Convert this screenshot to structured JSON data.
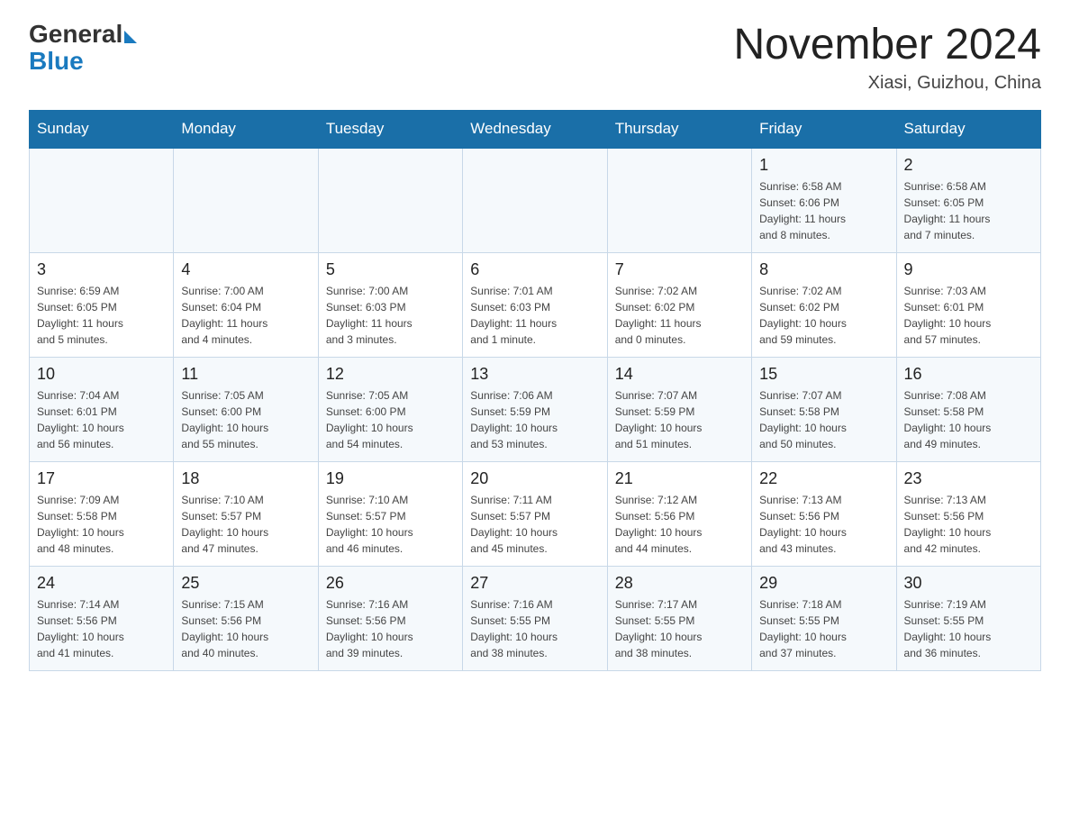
{
  "header": {
    "logo_general": "General",
    "logo_blue": "Blue",
    "title": "November 2024",
    "subtitle": "Xiasi, Guizhou, China"
  },
  "weekdays": [
    "Sunday",
    "Monday",
    "Tuesday",
    "Wednesday",
    "Thursday",
    "Friday",
    "Saturday"
  ],
  "weeks": [
    [
      {
        "day": "",
        "info": ""
      },
      {
        "day": "",
        "info": ""
      },
      {
        "day": "",
        "info": ""
      },
      {
        "day": "",
        "info": ""
      },
      {
        "day": "",
        "info": ""
      },
      {
        "day": "1",
        "info": "Sunrise: 6:58 AM\nSunset: 6:06 PM\nDaylight: 11 hours\nand 8 minutes."
      },
      {
        "day": "2",
        "info": "Sunrise: 6:58 AM\nSunset: 6:05 PM\nDaylight: 11 hours\nand 7 minutes."
      }
    ],
    [
      {
        "day": "3",
        "info": "Sunrise: 6:59 AM\nSunset: 6:05 PM\nDaylight: 11 hours\nand 5 minutes."
      },
      {
        "day": "4",
        "info": "Sunrise: 7:00 AM\nSunset: 6:04 PM\nDaylight: 11 hours\nand 4 minutes."
      },
      {
        "day": "5",
        "info": "Sunrise: 7:00 AM\nSunset: 6:03 PM\nDaylight: 11 hours\nand 3 minutes."
      },
      {
        "day": "6",
        "info": "Sunrise: 7:01 AM\nSunset: 6:03 PM\nDaylight: 11 hours\nand 1 minute."
      },
      {
        "day": "7",
        "info": "Sunrise: 7:02 AM\nSunset: 6:02 PM\nDaylight: 11 hours\nand 0 minutes."
      },
      {
        "day": "8",
        "info": "Sunrise: 7:02 AM\nSunset: 6:02 PM\nDaylight: 10 hours\nand 59 minutes."
      },
      {
        "day": "9",
        "info": "Sunrise: 7:03 AM\nSunset: 6:01 PM\nDaylight: 10 hours\nand 57 minutes."
      }
    ],
    [
      {
        "day": "10",
        "info": "Sunrise: 7:04 AM\nSunset: 6:01 PM\nDaylight: 10 hours\nand 56 minutes."
      },
      {
        "day": "11",
        "info": "Sunrise: 7:05 AM\nSunset: 6:00 PM\nDaylight: 10 hours\nand 55 minutes."
      },
      {
        "day": "12",
        "info": "Sunrise: 7:05 AM\nSunset: 6:00 PM\nDaylight: 10 hours\nand 54 minutes."
      },
      {
        "day": "13",
        "info": "Sunrise: 7:06 AM\nSunset: 5:59 PM\nDaylight: 10 hours\nand 53 minutes."
      },
      {
        "day": "14",
        "info": "Sunrise: 7:07 AM\nSunset: 5:59 PM\nDaylight: 10 hours\nand 51 minutes."
      },
      {
        "day": "15",
        "info": "Sunrise: 7:07 AM\nSunset: 5:58 PM\nDaylight: 10 hours\nand 50 minutes."
      },
      {
        "day": "16",
        "info": "Sunrise: 7:08 AM\nSunset: 5:58 PM\nDaylight: 10 hours\nand 49 minutes."
      }
    ],
    [
      {
        "day": "17",
        "info": "Sunrise: 7:09 AM\nSunset: 5:58 PM\nDaylight: 10 hours\nand 48 minutes."
      },
      {
        "day": "18",
        "info": "Sunrise: 7:10 AM\nSunset: 5:57 PM\nDaylight: 10 hours\nand 47 minutes."
      },
      {
        "day": "19",
        "info": "Sunrise: 7:10 AM\nSunset: 5:57 PM\nDaylight: 10 hours\nand 46 minutes."
      },
      {
        "day": "20",
        "info": "Sunrise: 7:11 AM\nSunset: 5:57 PM\nDaylight: 10 hours\nand 45 minutes."
      },
      {
        "day": "21",
        "info": "Sunrise: 7:12 AM\nSunset: 5:56 PM\nDaylight: 10 hours\nand 44 minutes."
      },
      {
        "day": "22",
        "info": "Sunrise: 7:13 AM\nSunset: 5:56 PM\nDaylight: 10 hours\nand 43 minutes."
      },
      {
        "day": "23",
        "info": "Sunrise: 7:13 AM\nSunset: 5:56 PM\nDaylight: 10 hours\nand 42 minutes."
      }
    ],
    [
      {
        "day": "24",
        "info": "Sunrise: 7:14 AM\nSunset: 5:56 PM\nDaylight: 10 hours\nand 41 minutes."
      },
      {
        "day": "25",
        "info": "Sunrise: 7:15 AM\nSunset: 5:56 PM\nDaylight: 10 hours\nand 40 minutes."
      },
      {
        "day": "26",
        "info": "Sunrise: 7:16 AM\nSunset: 5:56 PM\nDaylight: 10 hours\nand 39 minutes."
      },
      {
        "day": "27",
        "info": "Sunrise: 7:16 AM\nSunset: 5:55 PM\nDaylight: 10 hours\nand 38 minutes."
      },
      {
        "day": "28",
        "info": "Sunrise: 7:17 AM\nSunset: 5:55 PM\nDaylight: 10 hours\nand 38 minutes."
      },
      {
        "day": "29",
        "info": "Sunrise: 7:18 AM\nSunset: 5:55 PM\nDaylight: 10 hours\nand 37 minutes."
      },
      {
        "day": "30",
        "info": "Sunrise: 7:19 AM\nSunset: 5:55 PM\nDaylight: 10 hours\nand 36 minutes."
      }
    ]
  ]
}
